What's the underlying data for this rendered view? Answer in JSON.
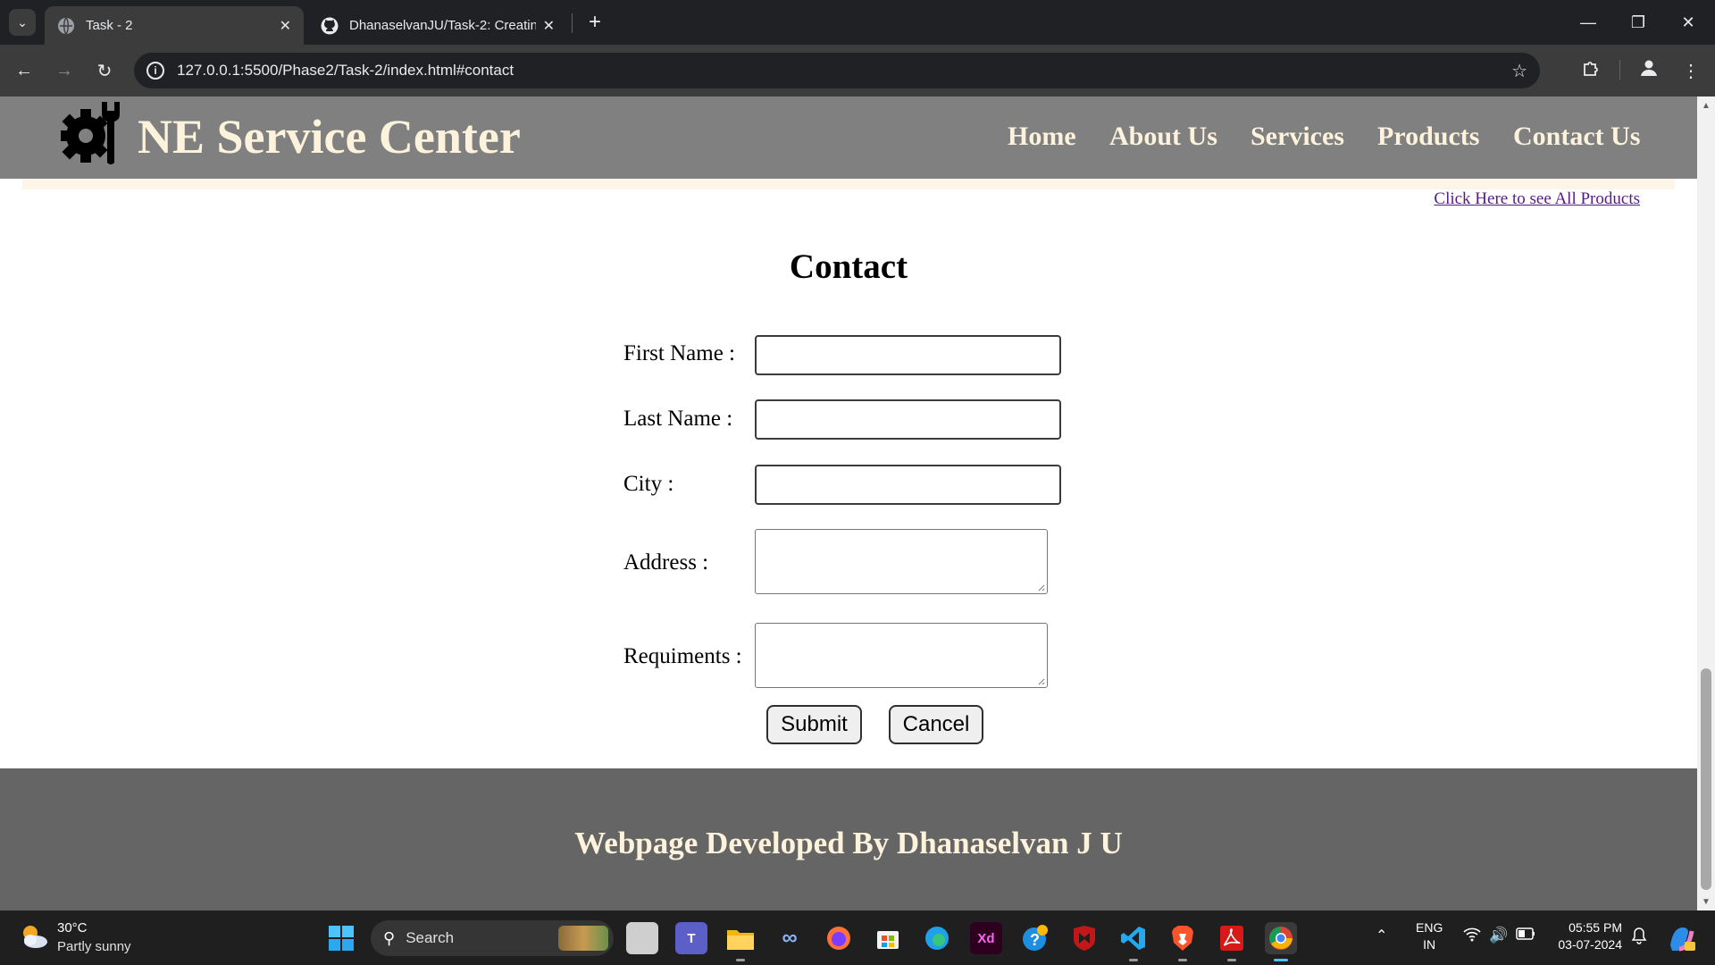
{
  "browser": {
    "tabs": [
      {
        "title": "Task - 2",
        "active": true
      },
      {
        "title": "DhanaselvanJU/Task-2: Creating",
        "active": false
      }
    ],
    "url": "127.0.0.1:5500/Phase2/Task-2/index.html#contact"
  },
  "site": {
    "title": "NE Service Center",
    "nav": [
      "Home",
      "About Us",
      "Services",
      "Products",
      "Contact Us"
    ],
    "all_products_link": "Click Here to see All Products",
    "colors": {
      "header": "#808080",
      "header_text": "#fdf2dc",
      "footer": "#656565"
    }
  },
  "contact": {
    "heading": "Contact",
    "fields": [
      {
        "label": "First Name :",
        "value": ""
      },
      {
        "label": "Last Name :",
        "value": ""
      },
      {
        "label": "City :",
        "value": ""
      },
      {
        "label": "Address :",
        "value": ""
      },
      {
        "label": "Requiments :",
        "value": ""
      }
    ],
    "submit_label": "Submit",
    "cancel_label": "Cancel"
  },
  "footer": {
    "text": "Webpage Developed By Dhanaselvan J U"
  },
  "taskbar": {
    "weather_temp": "30°C",
    "weather_desc": "Partly sunny",
    "search_label": "Search",
    "xd_label": "Xd",
    "lang_line1": "ENG",
    "lang_line2": "IN",
    "time": "05:55 PM",
    "date": "03-07-2024"
  }
}
